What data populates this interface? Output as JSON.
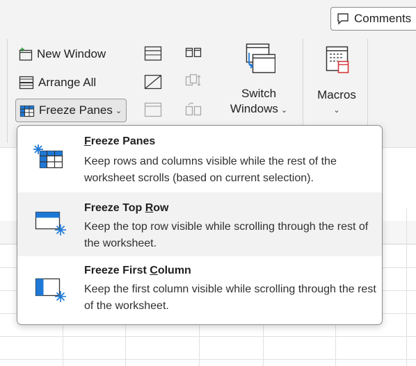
{
  "header": {
    "comments_label": "Comments"
  },
  "ribbon": {
    "new_window_label": "New Window",
    "arrange_all_label": "Arrange All",
    "freeze_panes_label": "Freeze Panes",
    "switch_windows_line1": "Switch",
    "switch_windows_line2": "Windows",
    "macros_label": "Macros"
  },
  "freeze_menu": {
    "items": [
      {
        "title_prefix": "",
        "title_mnemonic": "F",
        "title_suffix": "reeze Panes",
        "description": "Keep rows and columns visible while the rest of the worksheet scrolls (based on current selection)."
      },
      {
        "title_prefix": "Freeze Top ",
        "title_mnemonic": "R",
        "title_suffix": "ow",
        "description": "Keep the top row visible while scrolling through the rest of the worksheet."
      },
      {
        "title_prefix": "Freeze First ",
        "title_mnemonic": "C",
        "title_suffix": "olumn",
        "description": "Keep the first column visible while scrolling through the rest of the worksheet."
      }
    ]
  },
  "colors": {
    "accent_blue": "#1e78d6",
    "highlight": "#f2f2f2",
    "ribbon_bg": "#f3f3f3"
  }
}
